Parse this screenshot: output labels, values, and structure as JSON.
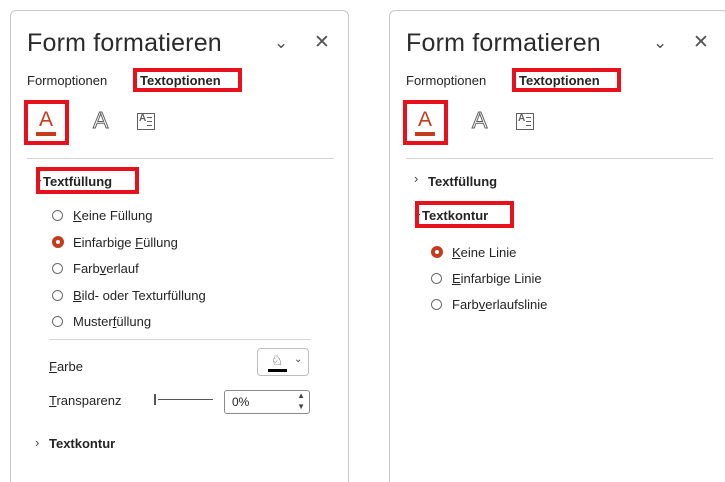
{
  "panes": [
    {
      "title": "Form formatieren",
      "tabs": {
        "shape_options": "Formoptionen",
        "text_options": "Textoptionen"
      },
      "icons": [
        "text-fill-outline-icon",
        "text-effects-icon",
        "textbox-icon"
      ],
      "icon_letters": {
        "fill": "A",
        "outline": "A",
        "textbox": "A"
      },
      "sections": {
        "fill": {
          "label": "Textfüllung",
          "expanded": true
        },
        "outline": {
          "label": "Textkontur",
          "expanded": false
        }
      },
      "fill_options": [
        {
          "label": "Keine Füllung",
          "selected": false
        },
        {
          "label": "Einfarbige Füllung",
          "selected": true
        },
        {
          "label": "Farbverlauf",
          "selected": false
        },
        {
          "label": "Bild- oder Texturfüllung",
          "selected": false
        },
        {
          "label": "Musterfüllung",
          "selected": false
        }
      ],
      "color_label": "Farbe",
      "color_value": "#000000",
      "transparency_label": "Transparenz",
      "transparency_value": "0%"
    },
    {
      "title": "Form formatieren",
      "tabs": {
        "shape_options": "Formoptionen",
        "text_options": "Textoptionen"
      },
      "icon_letters": {
        "fill": "A",
        "outline": "A",
        "textbox": "A"
      },
      "sections": {
        "fill": {
          "label": "Textfüllung",
          "expanded": false
        },
        "outline": {
          "label": "Textkontur",
          "expanded": true
        }
      },
      "outline_options": [
        {
          "label": "Keine Linie",
          "selected": true
        },
        {
          "label": "Einfarbige Linie",
          "selected": false
        },
        {
          "label": "Farbverlaufslinie",
          "selected": false
        }
      ]
    }
  ],
  "colors": {
    "highlight_box": "#e8101b",
    "accent": "#c43b1d",
    "text": "#242424",
    "border": "#c8c8c8"
  }
}
